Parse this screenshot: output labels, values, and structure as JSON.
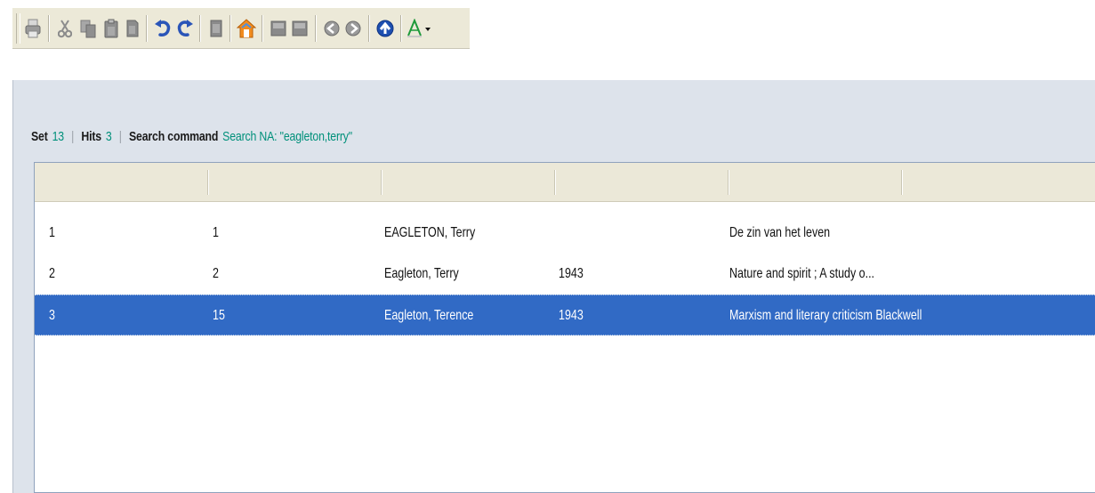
{
  "toolbar": {
    "buttons": [
      {
        "icon": "print-icon"
      },
      {
        "icon": "cut-icon"
      },
      {
        "icon": "copy-icon"
      },
      {
        "icon": "paste-icon"
      },
      {
        "icon": "document-icon"
      },
      {
        "icon": "undo-icon"
      },
      {
        "icon": "redo-icon"
      },
      {
        "icon": "page-icon"
      },
      {
        "icon": "home-icon"
      },
      {
        "icon": "record-icon"
      },
      {
        "icon": "record-2-icon"
      },
      {
        "icon": "back-icon"
      },
      {
        "icon": "forward-icon"
      },
      {
        "icon": "up-icon"
      },
      {
        "icon": "font-color-icon"
      }
    ]
  },
  "status": {
    "set_label": "Set",
    "set_value": "13",
    "hits_label": "Hits",
    "hits_value": "3",
    "command_label": "Search command",
    "command_value": "Search NA: \"eagleton,terry\""
  },
  "results": {
    "headers": [
      "",
      "",
      "",
      "",
      "",
      ""
    ],
    "rows": [
      {
        "c1": "1",
        "c2": "1",
        "c3": "EAGLETON, Terry",
        "c4": "",
        "c5": "De zin van het leven",
        "selected": false
      },
      {
        "c1": "2",
        "c2": "2",
        "c3": "Eagleton, Terry",
        "c4": "1943",
        "c5": "Nature and spirit ; A study o...",
        "selected": false
      },
      {
        "c1": "3",
        "c2": "15",
        "c3": "Eagleton, Terence",
        "c4": "1943",
        "c5": "Marxism and literary criticism  Blackwell",
        "selected": true
      }
    ]
  },
  "colors": {
    "accent_value": "#00907a",
    "selection": "#316ac5",
    "panel_bg": "#dde3eb"
  }
}
